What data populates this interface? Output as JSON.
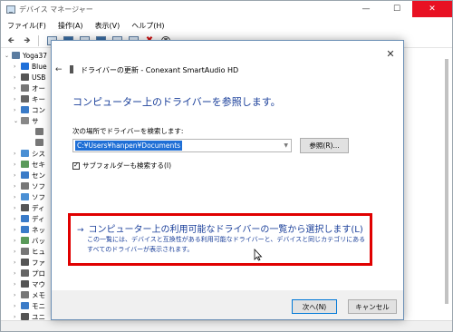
{
  "device_manager": {
    "title": "デバイス マネージャー",
    "menu": [
      "ファイル(F)",
      "操作(A)",
      "表示(V)",
      "ヘルプ(H)"
    ],
    "tree": [
      {
        "label": "Yoga37",
        "arrow": "⌄",
        "color": "#5b7ca0"
      },
      {
        "label": "Blue",
        "arrow": "›",
        "color": "#1e6fd9"
      },
      {
        "label": "USB",
        "arrow": "›",
        "color": "#555555"
      },
      {
        "label": "オー",
        "arrow": "›",
        "color": "#777777"
      },
      {
        "label": "キー",
        "arrow": "›",
        "color": "#666666"
      },
      {
        "label": "コン",
        "arrow": "›",
        "color": "#3a7bc8"
      },
      {
        "label": "サ",
        "arrow": "⌄",
        "color": "#888888"
      },
      {
        "label": "",
        "arrow": "",
        "color": "#777777"
      },
      {
        "label": "",
        "arrow": "",
        "color": "#777777"
      },
      {
        "label": "シス",
        "arrow": "›",
        "color": "#4a8fd4"
      },
      {
        "label": "セキ",
        "arrow": "›",
        "color": "#5a9a5a"
      },
      {
        "label": "セン",
        "arrow": "›",
        "color": "#3a7bc8"
      },
      {
        "label": "ソフ",
        "arrow": "›",
        "color": "#777777"
      },
      {
        "label": "ソフ",
        "arrow": "›",
        "color": "#4a8fd4"
      },
      {
        "label": "ディ",
        "arrow": "›",
        "color": "#555555"
      },
      {
        "label": "ディ",
        "arrow": "›",
        "color": "#3a7bc8"
      },
      {
        "label": "ネッ",
        "arrow": "›",
        "color": "#3a7bc8"
      },
      {
        "label": "バッ",
        "arrow": "›",
        "color": "#5a9a5a"
      },
      {
        "label": "ヒュ",
        "arrow": "›",
        "color": "#777777"
      },
      {
        "label": "ファ",
        "arrow": "›",
        "color": "#555555"
      },
      {
        "label": "プロ",
        "arrow": "›",
        "color": "#666666"
      },
      {
        "label": "マウ",
        "arrow": "›",
        "color": "#555555"
      },
      {
        "label": "メモ",
        "arrow": "›",
        "color": "#777777"
      },
      {
        "label": "モニ",
        "arrow": "›",
        "color": "#3a7bc8"
      },
      {
        "label": "ユニ",
        "arrow": "›",
        "color": "#555555"
      }
    ]
  },
  "dialog": {
    "back_glyph": "←",
    "close_glyph": "✕",
    "title": "ドライバーの更新 - Conexant SmartAudio HD",
    "heading": "コンピューター上のドライバーを参照します。",
    "location_label": "次の場所でドライバーを検索します:",
    "path_value": "C:¥Users¥hanpen¥Documents",
    "browse_label": "参照(R)...",
    "subfolder_label": "サブフォルダーも検索する(I)",
    "subfolder_checked": "✓",
    "pick_arrow": "→",
    "pick_label": "コンピューター上の利用可能なドライバーの一覧から選択します(L)",
    "pick_description": "この一覧には、デバイスと互換性がある利用可能なドライバーと、デバイスと同じカテゴリにあるすべてのドライバーが表示されます。",
    "next_label": "次へ(N)",
    "cancel_label": "キャンセル"
  },
  "colors": {
    "link_blue": "#1a3f9a",
    "highlight_red": "#e00000",
    "selection_blue": "#1f6fd6"
  }
}
